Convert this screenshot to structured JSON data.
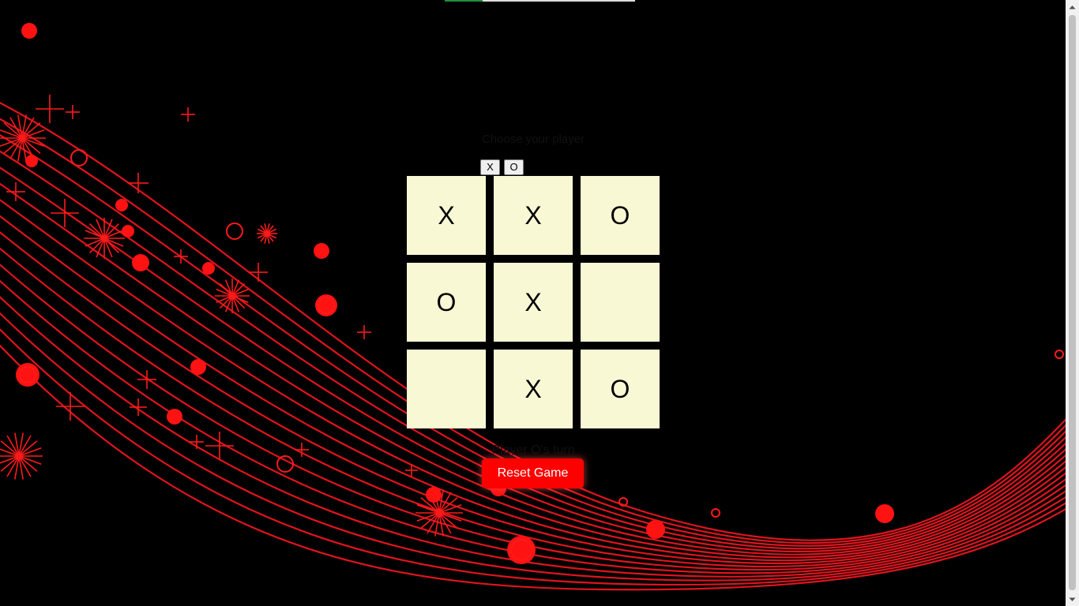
{
  "progress": {
    "value": 0.2,
    "fill_color": "#1f8f3f"
  },
  "chooser": {
    "label": "Choose your player",
    "x_label": "X",
    "o_label": "O"
  },
  "board": {
    "cells": [
      "X",
      "X",
      "O",
      "O",
      "X",
      "",
      "",
      "X",
      "O"
    ],
    "cell_color": "#f8f8d4"
  },
  "status": "Player O's turn",
  "reset_label": "Reset Game",
  "colors": {
    "background": "#000000",
    "accent": "#ff0000",
    "decoration": "#ff1a1a"
  },
  "icons": {
    "scroll_up": "chevron-up-icon",
    "scroll_down": "chevron-down-icon"
  }
}
